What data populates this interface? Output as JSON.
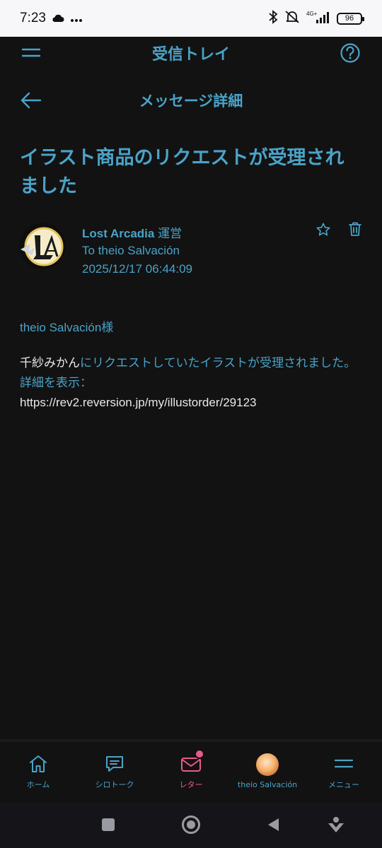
{
  "status_bar": {
    "time": "7:23",
    "signal": "4G+",
    "battery": "96"
  },
  "header": {
    "title": "受信トレイ"
  },
  "subheader": {
    "title": "メッセージ詳細"
  },
  "message": {
    "title": "イラスト商品のリクエストが受理されました",
    "sender_name": "Lost Arcadia",
    "sender_suffix": "運営",
    "to": "To theio Salvación",
    "date": "2025/12/17 06:44:09",
    "greeting": "theio Salvación様",
    "body_name": "千紗みかん",
    "body_text": "にリクエストしていたイラストが受理されました。",
    "detail_label": "詳細を表示：",
    "detail_url": "https://rev2.reversion.jp/my/illustorder/29123"
  },
  "bottom_nav": {
    "items": [
      {
        "label": "ホーム",
        "icon": "home-icon"
      },
      {
        "label": "シロトーク",
        "icon": "chat-icon"
      },
      {
        "label": "レター",
        "icon": "mail-icon",
        "active": true
      },
      {
        "label": "theio Salvación",
        "icon": "avatar"
      },
      {
        "label": "メニュー",
        "icon": "menu-icon"
      }
    ]
  },
  "colors": {
    "accent": "#4aa3c8",
    "active": "#e85a8a",
    "background": "#121212"
  }
}
